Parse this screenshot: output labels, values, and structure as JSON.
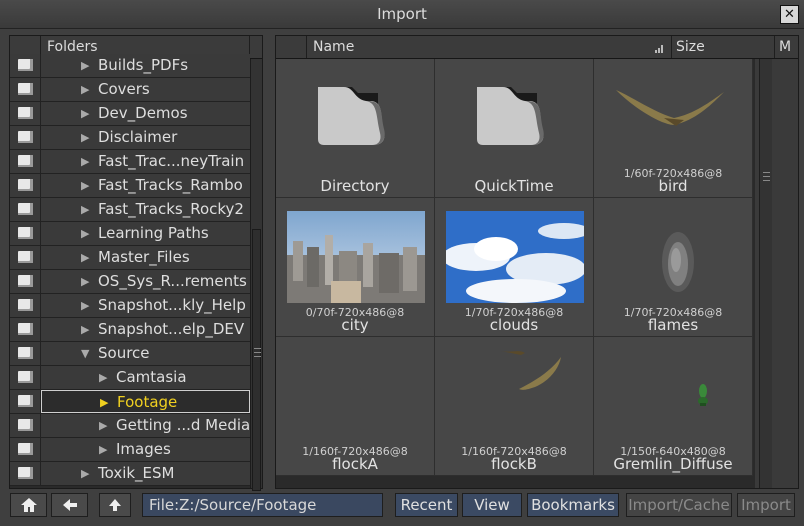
{
  "window": {
    "title": "Import",
    "close_glyph": "✕"
  },
  "folders": {
    "header": "Folders",
    "items": [
      {
        "label": "Builds_PDFs",
        "level": 0,
        "selected": false
      },
      {
        "label": "Covers",
        "level": 0,
        "selected": false
      },
      {
        "label": "Dev_Demos",
        "level": 0,
        "selected": false
      },
      {
        "label": "Disclaimer",
        "level": 0,
        "selected": false
      },
      {
        "label": "Fast_Trac...neyTrain",
        "level": 0,
        "selected": false
      },
      {
        "label": "Fast_Tracks_Rambo",
        "level": 0,
        "selected": false
      },
      {
        "label": "Fast_Tracks_Rocky2",
        "level": 0,
        "selected": false
      },
      {
        "label": "Learning Paths",
        "level": 0,
        "selected": false
      },
      {
        "label": "Master_Files",
        "level": 0,
        "selected": false
      },
      {
        "label": "OS_Sys_R...rements",
        "level": 0,
        "selected": false
      },
      {
        "label": "Snapshot...kly_Help",
        "level": 0,
        "selected": false
      },
      {
        "label": "Snapshot...elp_DEV",
        "level": 0,
        "selected": false
      },
      {
        "label": "Source",
        "level": 0,
        "selected": false,
        "expanded": true
      },
      {
        "label": "Camtasia",
        "level": 1,
        "selected": false
      },
      {
        "label": "Footage",
        "level": 1,
        "selected": true
      },
      {
        "label": "Getting ...d Media",
        "level": 1,
        "selected": false
      },
      {
        "label": "Images",
        "level": 1,
        "selected": false
      },
      {
        "label": "Toxik_ESM",
        "level": 0,
        "selected": false
      }
    ]
  },
  "files": {
    "columns": {
      "name": "Name",
      "size": "Size",
      "more": "M"
    },
    "items": [
      {
        "name": "Directory",
        "meta": "",
        "thumb": "folder"
      },
      {
        "name": "QuickTime",
        "meta": "",
        "thumb": "folder"
      },
      {
        "name": "bird",
        "meta": "1/60f-720x486@8",
        "thumb": "bird"
      },
      {
        "name": "city",
        "meta": "0/70f-720x486@8",
        "thumb": "city"
      },
      {
        "name": "clouds",
        "meta": "1/70f-720x486@8",
        "thumb": "clouds"
      },
      {
        "name": "flames",
        "meta": "1/70f-720x486@8",
        "thumb": "flames"
      },
      {
        "name": "flockA",
        "meta": "1/160f-720x486@8",
        "thumb": "empty"
      },
      {
        "name": "flockB",
        "meta": "1/160f-720x486@8",
        "thumb": "bird2"
      },
      {
        "name": "Gremlin_Diffuse",
        "meta": "1/150f-640x480@8",
        "thumb": "gremlin"
      }
    ]
  },
  "bottombar": {
    "path": "File:Z:/Source/Footage",
    "recent": "Recent",
    "view": "View",
    "bookmarks": "Bookmarks",
    "import_cache": "Import/Cache",
    "import": "Import"
  }
}
